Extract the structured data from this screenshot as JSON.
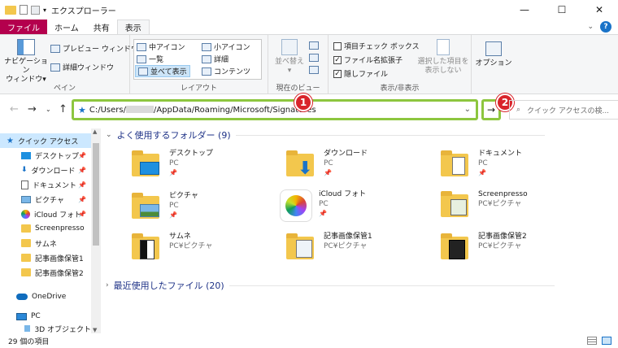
{
  "window": {
    "title": "エクスプローラー",
    "minimize": "—",
    "maximize": "☐",
    "close": "✕"
  },
  "tabs": [
    {
      "label": "ファイル"
    },
    {
      "label": "ホーム"
    },
    {
      "label": "共有"
    },
    {
      "label": "表示"
    }
  ],
  "ribbon": {
    "pane_group": {
      "nav_pane_line1": "ナビゲーション",
      "nav_pane_line2": "ウィンドウ▾",
      "preview": "プレビュー ウィンドウ",
      "details": "詳細ウィンドウ",
      "label": "ペイン"
    },
    "layout_group": {
      "items": [
        "中アイコン",
        "小アイコン",
        "一覧",
        "詳細",
        "並べて表示",
        "コンテンツ"
      ],
      "label": "レイアウト"
    },
    "current_view": {
      "sort_line1": "並べ替え",
      "sort_line2": "▾",
      "label": "現在のビュー"
    },
    "show_hide": {
      "item_checkbox": "項目チェック ボックス",
      "file_ext": "ファイル名拡張子",
      "hidden": "隠しファイル",
      "hide_sel_line1": "選択した項目を",
      "hide_sel_line2": "表示しない",
      "label": "表示/非表示"
    },
    "options": {
      "label": "オプション"
    }
  },
  "nav": {
    "address_prefix": "C:/Users/",
    "address_suffix": "/AppData/Roaming/Microsoft/Signatures",
    "search_placeholder": "クイック アクセスの検...",
    "badge1": "1",
    "badge2": "2"
  },
  "sidebar": {
    "items": [
      {
        "label": "クイック アクセス"
      },
      {
        "label": "デスクトップ"
      },
      {
        "label": "ダウンロード"
      },
      {
        "label": "ドキュメント"
      },
      {
        "label": "ピクチャ"
      },
      {
        "label": "iCloud フォト"
      },
      {
        "label": "Screenpresso"
      },
      {
        "label": "サムネ"
      },
      {
        "label": "記事画像保管1"
      },
      {
        "label": "記事画像保管2"
      },
      {
        "label": "OneDrive"
      },
      {
        "label": "PC"
      },
      {
        "label": "3D オブジェクト"
      }
    ]
  },
  "content": {
    "frequent_header": "よく使用するフォルダー (9)",
    "recent_header": "最近使用したファイル (20)",
    "folders": [
      {
        "name": "デスクトップ",
        "location": "PC",
        "pinned": true
      },
      {
        "name": "ダウンロード",
        "location": "PC",
        "pinned": true
      },
      {
        "name": "ドキュメント",
        "location": "PC",
        "pinned": true
      },
      {
        "name": "ピクチャ",
        "location": "PC",
        "pinned": true
      },
      {
        "name": "iCloud フォト",
        "location": "PC",
        "pinned": true
      },
      {
        "name": "Screenpresso",
        "location": "PC¥ピクチャ",
        "pinned": false
      },
      {
        "name": "サムネ",
        "location": "PC¥ピクチャ",
        "pinned": false
      },
      {
        "name": "記事画像保管1",
        "location": "PC¥ピクチャ",
        "pinned": false
      },
      {
        "name": "記事画像保管2",
        "location": "PC¥ピクチャ",
        "pinned": false
      }
    ]
  },
  "status": {
    "count": "29 個の項目"
  },
  "colors": {
    "file_tab": "#b4004d",
    "highlight_green": "#8dc63f",
    "badge_red": "#d9242b",
    "folder_yellow": "#f3c74d",
    "header_blue": "#1e3287"
  }
}
